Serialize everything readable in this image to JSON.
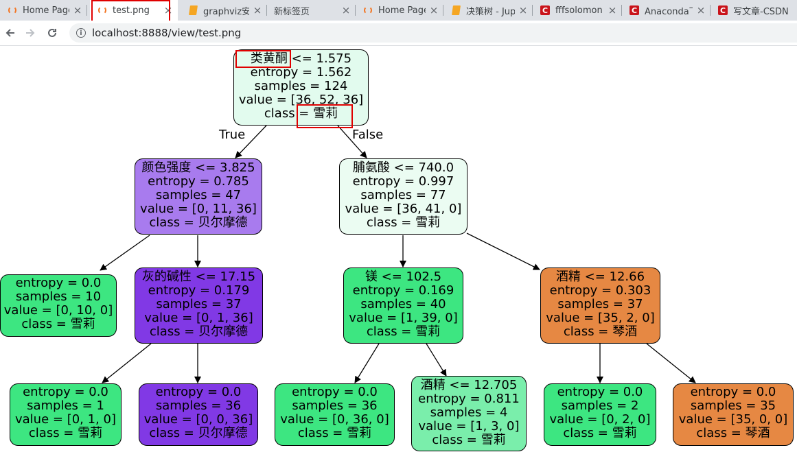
{
  "tabs": [
    {
      "label": "Home Page",
      "icon": "jupyter-icon",
      "active": false
    },
    {
      "label": "test.png",
      "icon": "jupyter-icon",
      "active": true
    },
    {
      "label": "graphviz安装",
      "icon": "book-icon",
      "active": false
    },
    {
      "label": "新标签页",
      "icon": "",
      "active": false
    },
    {
      "label": "Home Page",
      "icon": "jupyter-icon",
      "active": false
    },
    {
      "label": "决策树 - Jupyter",
      "icon": "book-icon",
      "active": false
    },
    {
      "label": "fffsolomon",
      "icon": "csdn-icon",
      "active": false
    },
    {
      "label": "Anaconda下",
      "icon": "csdn-icon",
      "active": false
    },
    {
      "label": "写文章-CSDN",
      "icon": "csdn-icon",
      "active": false
    }
  ],
  "close_glyph": "×",
  "csdn_letter": "C",
  "address": {
    "url": "localhost:8888/view/test.png"
  },
  "tree": {
    "edge_labels": {
      "true": "True",
      "false": "False"
    },
    "colors": {
      "root": "#e2fbee",
      "light_purple": "#a87bee",
      "dark_purple": "#8139e5",
      "very_light_green": "#ebfcf2",
      "green": "#3de681",
      "orange": "#e68843",
      "pale_green": "#7aeeab",
      "highlight": "#e00000"
    },
    "nodes": [
      {
        "id": "root",
        "split": "类黄酮 <= 1.575",
        "entropy": "entropy = 1.562",
        "samples": "samples = 124",
        "value": "value = [36, 52, 36]",
        "class": "class = 雪莉"
      },
      {
        "id": "n1",
        "split": "颜色强度 <= 3.825",
        "entropy": "entropy = 0.785",
        "samples": "samples = 47",
        "value": "value = [0, 11, 36]",
        "class": "class = 贝尔摩德"
      },
      {
        "id": "n2",
        "split": "脯氨酸 <= 740.0",
        "entropy": "entropy = 0.997",
        "samples": "samples = 77",
        "value": "value = [36, 41, 0]",
        "class": "class = 雪莉"
      },
      {
        "id": "n3",
        "entropy": "entropy = 0.0",
        "samples": "samples = 10",
        "value": "value = [0, 10, 0]",
        "class": "class = 雪莉"
      },
      {
        "id": "n4",
        "split": "灰的碱性 <= 17.15",
        "entropy": "entropy = 0.179",
        "samples": "samples = 37",
        "value": "value = [0, 1, 36]",
        "class": "class = 贝尔摩德"
      },
      {
        "id": "n5",
        "split": "镁 <= 102.5",
        "entropy": "entropy = 0.169",
        "samples": "samples = 40",
        "value": "value = [1, 39, 0]",
        "class": "class = 雪莉"
      },
      {
        "id": "n6",
        "split": "酒精 <= 12.66",
        "entropy": "entropy = 0.303",
        "samples": "samples = 37",
        "value": "value = [35, 2, 0]",
        "class": "class = 琴酒"
      },
      {
        "id": "n7",
        "entropy": "entropy = 0.0",
        "samples": "samples = 1",
        "value": "value = [0, 1, 0]",
        "class": "class = 雪莉"
      },
      {
        "id": "n8",
        "entropy": "entropy = 0.0",
        "samples": "samples = 36",
        "value": "value = [0, 0, 36]",
        "class": "class = 贝尔摩德"
      },
      {
        "id": "n9",
        "entropy": "entropy = 0.0",
        "samples": "samples = 36",
        "value": "value = [0, 36, 0]",
        "class": "class = 雪莉"
      },
      {
        "id": "n10",
        "split": "酒精 <= 12.705",
        "entropy": "entropy = 0.811",
        "samples": "samples = 4",
        "value": "value = [1, 3, 0]",
        "class": "class = 雪莉"
      },
      {
        "id": "n11",
        "entropy": "entropy = 0.0",
        "samples": "samples = 2",
        "value": "value = [0, 2, 0]",
        "class": "class = 雪莉"
      },
      {
        "id": "n12",
        "entropy": "entropy = 0.0",
        "samples": "samples = 35",
        "value": "value = [35, 0, 0]",
        "class": "class = 琴酒"
      }
    ]
  }
}
